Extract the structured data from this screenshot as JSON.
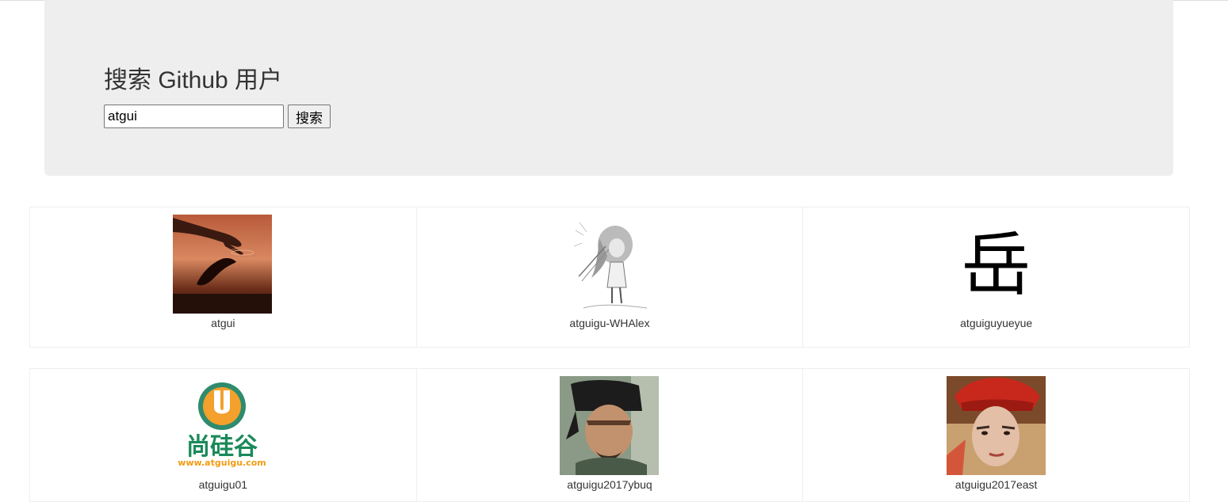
{
  "header": {
    "title": "搜索 Github 用户",
    "search_value": "atgui",
    "search_button_label": "搜索"
  },
  "users": [
    {
      "login": "atgui",
      "avatar_icon": "hand-water-reflection-avatar"
    },
    {
      "login": "atguigu-WHAlex",
      "avatar_icon": "sketch-girl-avatar"
    },
    {
      "login": "atguiguyueyue",
      "avatar_icon": "yue-character-avatar",
      "avatar_text": "岳"
    },
    {
      "login": "atguigu01",
      "avatar_icon": "atguigu-logo-avatar",
      "logo_text": "尚硅谷",
      "logo_url_text": "www.atguigu.com"
    },
    {
      "login": "atguigu2017ybuq",
      "avatar_icon": "swordsman-portrait-avatar"
    },
    {
      "login": "atguigu2017east",
      "avatar_icon": "red-hat-portrait-avatar"
    }
  ]
}
